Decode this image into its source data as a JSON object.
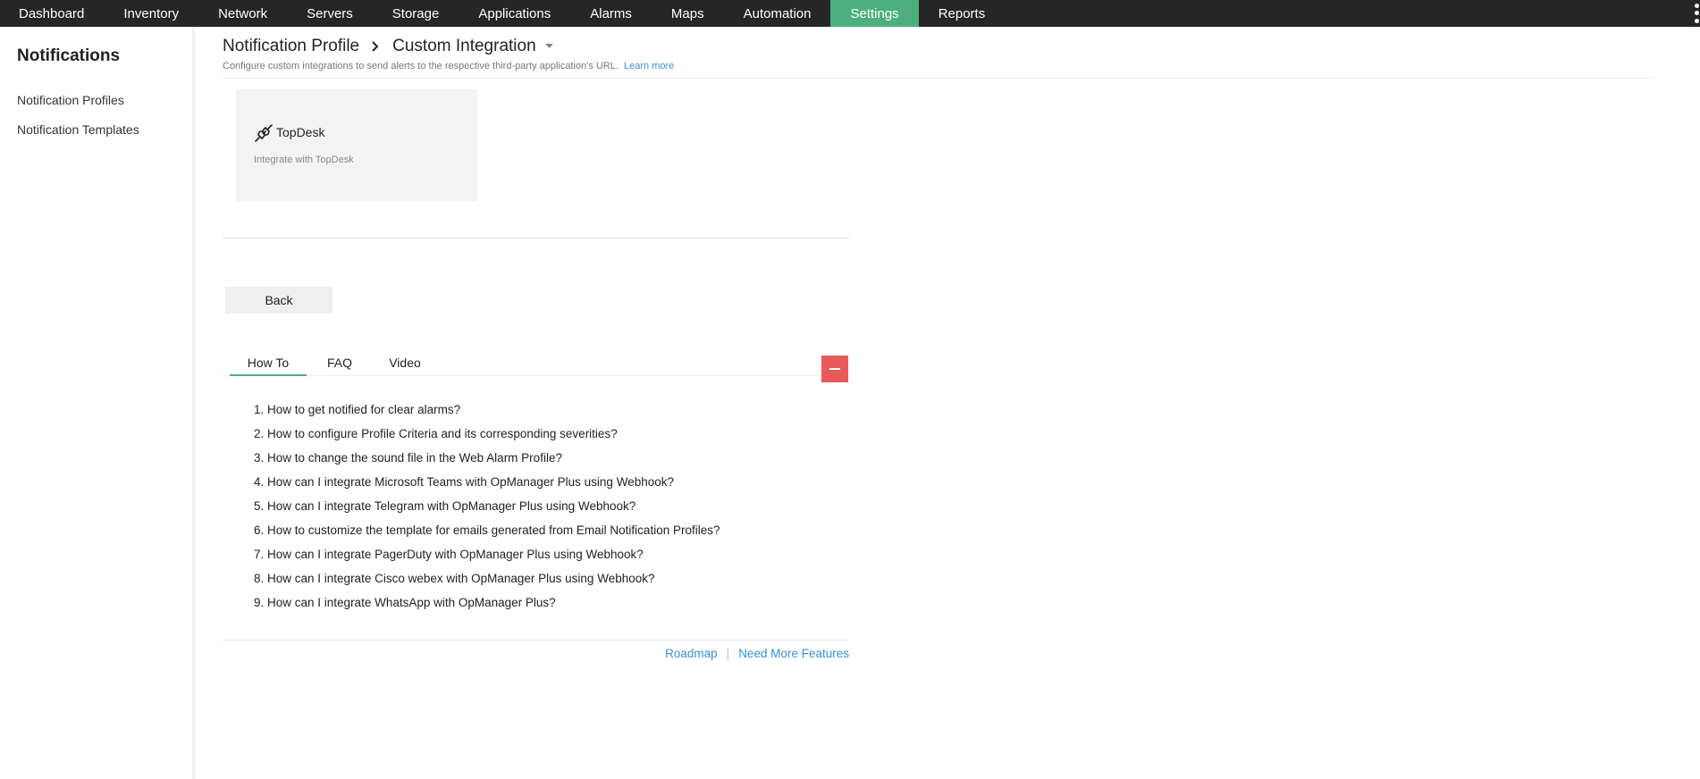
{
  "nav": {
    "items": [
      "Dashboard",
      "Inventory",
      "Network",
      "Servers",
      "Storage",
      "Applications",
      "Alarms",
      "Maps",
      "Automation",
      "Settings",
      "Reports"
    ],
    "active": "Settings",
    "accent_color": "#4caf7d"
  },
  "sidebar": {
    "title": "Notifications",
    "links": [
      "Notification Profiles",
      "Notification Templates"
    ]
  },
  "breadcrumb": {
    "parent": "Notification Profile",
    "current": "Custom Integration"
  },
  "subtitle": {
    "text": "Configure custom integrations to send alerts to the respective third-party application's URL.",
    "link": "Learn more"
  },
  "card": {
    "icon": "plug-icon",
    "title": "TopDesk",
    "description": "Integrate with TopDesk"
  },
  "back_label": "Back",
  "tabs": [
    "How To",
    "FAQ",
    "Video"
  ],
  "active_tab": "How To",
  "collapse_color": "#e85a5a",
  "howto": [
    "How to get notified for clear alarms?",
    "How to configure Profile Criteria and its corresponding severities?",
    "How to change the sound file in the Web Alarm Profile?",
    "How can I integrate Microsoft Teams with OpManager Plus using Webhook?",
    "How can I integrate Telegram with OpManager Plus using Webhook?",
    "How to customize the template for emails generated from Email Notification Profiles?",
    "How can I integrate PagerDuty with OpManager Plus using Webhook?",
    "How can I integrate Cisco webex with OpManager Plus using Webhook?",
    "How can I integrate WhatsApp with OpManager Plus?"
  ],
  "footer": {
    "roadmap": "Roadmap",
    "divider": "|",
    "more": "Need More Features"
  }
}
